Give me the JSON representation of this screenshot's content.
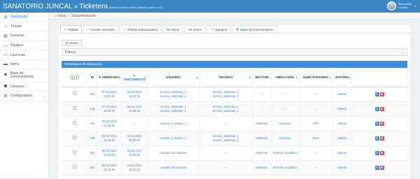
{
  "header": {
    "app_name": "SANATORIO JUNCAL",
    "separator": "»",
    "module": "Ticketera",
    "branch_info": "(Branch Common: master | Branch Common: v4.0)",
    "user_greeting": "Bienvenido,",
    "user_name": "Luciano"
  },
  "sidebar": {
    "items": [
      {
        "label": "Dashboard",
        "icon": "dashboard-icon",
        "glyph": "◍"
      },
      {
        "label": "Tickets",
        "icon": "tag-icon",
        "glyph": "⌂"
      },
      {
        "label": "Facturas",
        "icon": "document-icon",
        "glyph": "▤"
      },
      {
        "label": "Equipos",
        "icon": "monitor-icon",
        "glyph": "▭"
      },
      {
        "label": "Licencias",
        "icon": "monitor-icon",
        "glyph": "▭"
      },
      {
        "label": "Items",
        "icon": "list-icon",
        "glyph": "▬"
      },
      {
        "label": "Base de Conocimientos",
        "icon": "book-icon",
        "glyph": "◉"
      },
      {
        "label": "Usuarios",
        "icon": "users-icon",
        "glyph": "⚉"
      },
      {
        "label": "Configuración",
        "icon": "gear-icon",
        "glyph": "⚙"
      }
    ]
  },
  "breadcrumb": {
    "home": "Inicio",
    "separator": "›",
    "current": "Documentación"
  },
  "tabs": [
    {
      "label": "Tickets",
      "icon": "tag-icon",
      "glyph": "⌂",
      "color": "#333"
    },
    {
      "label": "Tickets Vencidos",
      "icon": "tag-icon",
      "glyph": "⌂",
      "color": "#d9534f"
    },
    {
      "label": "Tickets Solucionados",
      "icon": "tag-icon",
      "glyph": "⌂",
      "color": "#5cb85c"
    },
    {
      "label": "Items",
      "icon": "list-icon",
      "glyph": "▬",
      "color": "#5cb85c"
    },
    {
      "label": "Stock",
      "icon": "list-icon",
      "glyph": "▬",
      "color": "#5cb85c"
    },
    {
      "label": "Equipos",
      "icon": "monitor-icon",
      "glyph": "▭",
      "color": "#5cb85c"
    },
    {
      "label": "Base de Conocimiento",
      "icon": "book-icon",
      "glyph": "◉",
      "color": "#5cb85c"
    }
  ],
  "new_button": "Nuevo",
  "filters_label": "Filtros",
  "results_label": "Resultados de Búsqueda",
  "table": {
    "columns": [
      "ID",
      "F. APERTURA",
      "F. VENCIMIENTO",
      "USUARIO",
      "TECNICO",
      "SECTOR",
      "UBICACION",
      "SUBCATEGORIA",
      "ESTADO"
    ],
    "rows": [
      {
        "id": "124",
        "apertura": "07-10-2014 13:34 hs",
        "vencimiento": "15-10-2014 13:33 hs",
        "usuario": "tecnico_sistemas_1 tecnico_sistemas_1",
        "tecnico": "tecnico_sistemas_1 tecnico_sistemas_1",
        "sector": "---",
        "ubicacion": "---",
        "subcategoria": "---",
        "estado": "Abierto"
      },
      {
        "id": "125",
        "apertura": "07-10-2014 13:36 hs",
        "vencimiento": "30-10-2014 13:36 hs",
        "usuario": "tecnico_sistemas_1 tecnico_sistemas_1",
        "tecnico": "tecnico_sistemas_1 tecnico_sistemas_1",
        "sector": "---",
        "ubicacion": "---",
        "subcategoria": "---",
        "estado": "Abierto"
      },
      {
        "id": "128",
        "apertura": "08-10-2014 15:26 hs",
        "vencimiento": "---",
        "usuario": "usuario_1 usuario_1",
        "tecnico": "---",
        "sector": "Sistemas",
        "ubicacion": "Gerencia",
        "subcategoria": "HDD",
        "estado": "Abierto"
      },
      {
        "id": "130",
        "apertura": "08-10-2014 15:28 hs",
        "vencimiento": "30-10-2014 00:00 hs",
        "usuario": "usuario_1 usuario_1",
        "tecnico": "tecnico_sistemas_1 tecnico_sistemas_1",
        "sector": "Sistemas",
        "ubicacion": "Gerencia",
        "subcategoria": "Toner",
        "estado": "Abierto"
      },
      {
        "id": "152",
        "apertura": "09-10-2014 14:29 hs",
        "vencimiento": "16-10-2014 14:29 hs",
        "usuario": "Leandro Gil Carrano",
        "tecnico": "---",
        "sector": "Sistemas",
        "ubicacion": "Atención al público",
        "subcategoria": "---",
        "estado": "Abierto"
      },
      {
        "id": "154",
        "apertura": "09-10-2014 14:31 hs",
        "vencimiento": "16-10-2014 14:31 hs",
        "usuario": "Leandro Gil Carrano",
        "tecnico": "---",
        "sector": "Sistemas",
        "ubicacion": "Atención al público",
        "subcategoria": "---",
        "estado": "Abierto"
      }
    ]
  },
  "colors": {
    "header_bg": "#3b87c4",
    "results_bg": "#3c8ed9",
    "link": "#2f7fd0",
    "edit_btn": "#3c8ed9",
    "delete_btn": "#d9534f"
  }
}
